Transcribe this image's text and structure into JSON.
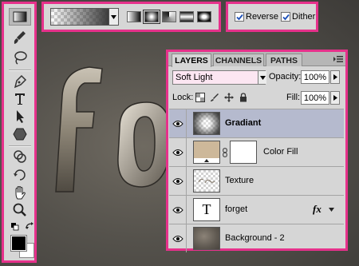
{
  "canvas": {
    "artwork_text": "forge"
  },
  "toolbox": {
    "tools": [
      "marquee-tool",
      "lasso-tool",
      "quick-selection-tool",
      "pen-tool",
      "type-tool",
      "path-selection-tool",
      "shape-tool",
      "smudge-tool",
      "rotate-view-tool",
      "hand-tool",
      "zoom-tool"
    ],
    "active_tool": "gradient-tool",
    "foreground_color": "#000000",
    "background_color": "#ffffff"
  },
  "gradient_options": {
    "types": [
      "linear",
      "radial",
      "angle",
      "reflected",
      "diamond"
    ],
    "selected_type": "radial"
  },
  "checkboxes": {
    "reverse_label": "Reverse",
    "reverse_checked": true,
    "dither_label": "Dither",
    "dither_checked": true
  },
  "layers_panel": {
    "tabs": [
      "LAYERS",
      "CHANNELS",
      "PATHS"
    ],
    "active_tab": "LAYERS",
    "blend_mode": "Soft Light",
    "opacity_label": "Opacity:",
    "opacity_value": "100%",
    "lock_label": "Lock:",
    "fill_label": "Fill:",
    "fill_value": "100%",
    "layers": [
      {
        "name": "Gradiant",
        "selected": true,
        "bold": true
      },
      {
        "name": "Color Fill",
        "selected": false
      },
      {
        "name": "Texture",
        "selected": false
      },
      {
        "name": "forget",
        "selected": false,
        "type_glyph": "T",
        "fx": "fx"
      },
      {
        "name": "Background - 2",
        "selected": false
      }
    ]
  },
  "colors": {
    "highlight_border": "#e6318b",
    "blend_field_bg": "#fce6f2",
    "selected_layer_bg": "#b5bace",
    "color_fill_swatch": "#cdb89a"
  }
}
